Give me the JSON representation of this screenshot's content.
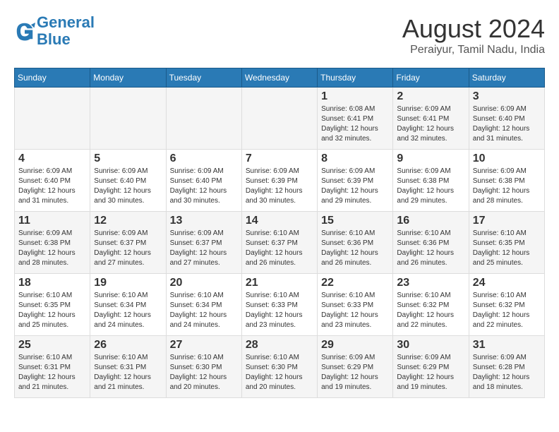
{
  "logo": {
    "line1": "General",
    "line2": "Blue"
  },
  "title": "August 2024",
  "subtitle": "Peraiyur, Tamil Nadu, India",
  "days_of_week": [
    "Sunday",
    "Monday",
    "Tuesday",
    "Wednesday",
    "Thursday",
    "Friday",
    "Saturday"
  ],
  "weeks": [
    [
      {
        "day": "",
        "info": ""
      },
      {
        "day": "",
        "info": ""
      },
      {
        "day": "",
        "info": ""
      },
      {
        "day": "",
        "info": ""
      },
      {
        "day": "1",
        "info": "Sunrise: 6:08 AM\nSunset: 6:41 PM\nDaylight: 12 hours\nand 32 minutes."
      },
      {
        "day": "2",
        "info": "Sunrise: 6:09 AM\nSunset: 6:41 PM\nDaylight: 12 hours\nand 32 minutes."
      },
      {
        "day": "3",
        "info": "Sunrise: 6:09 AM\nSunset: 6:40 PM\nDaylight: 12 hours\nand 31 minutes."
      }
    ],
    [
      {
        "day": "4",
        "info": "Sunrise: 6:09 AM\nSunset: 6:40 PM\nDaylight: 12 hours\nand 31 minutes."
      },
      {
        "day": "5",
        "info": "Sunrise: 6:09 AM\nSunset: 6:40 PM\nDaylight: 12 hours\nand 30 minutes."
      },
      {
        "day": "6",
        "info": "Sunrise: 6:09 AM\nSunset: 6:40 PM\nDaylight: 12 hours\nand 30 minutes."
      },
      {
        "day": "7",
        "info": "Sunrise: 6:09 AM\nSunset: 6:39 PM\nDaylight: 12 hours\nand 30 minutes."
      },
      {
        "day": "8",
        "info": "Sunrise: 6:09 AM\nSunset: 6:39 PM\nDaylight: 12 hours\nand 29 minutes."
      },
      {
        "day": "9",
        "info": "Sunrise: 6:09 AM\nSunset: 6:38 PM\nDaylight: 12 hours\nand 29 minutes."
      },
      {
        "day": "10",
        "info": "Sunrise: 6:09 AM\nSunset: 6:38 PM\nDaylight: 12 hours\nand 28 minutes."
      }
    ],
    [
      {
        "day": "11",
        "info": "Sunrise: 6:09 AM\nSunset: 6:38 PM\nDaylight: 12 hours\nand 28 minutes."
      },
      {
        "day": "12",
        "info": "Sunrise: 6:09 AM\nSunset: 6:37 PM\nDaylight: 12 hours\nand 27 minutes."
      },
      {
        "day": "13",
        "info": "Sunrise: 6:09 AM\nSunset: 6:37 PM\nDaylight: 12 hours\nand 27 minutes."
      },
      {
        "day": "14",
        "info": "Sunrise: 6:10 AM\nSunset: 6:37 PM\nDaylight: 12 hours\nand 26 minutes."
      },
      {
        "day": "15",
        "info": "Sunrise: 6:10 AM\nSunset: 6:36 PM\nDaylight: 12 hours\nand 26 minutes."
      },
      {
        "day": "16",
        "info": "Sunrise: 6:10 AM\nSunset: 6:36 PM\nDaylight: 12 hours\nand 26 minutes."
      },
      {
        "day": "17",
        "info": "Sunrise: 6:10 AM\nSunset: 6:35 PM\nDaylight: 12 hours\nand 25 minutes."
      }
    ],
    [
      {
        "day": "18",
        "info": "Sunrise: 6:10 AM\nSunset: 6:35 PM\nDaylight: 12 hours\nand 25 minutes."
      },
      {
        "day": "19",
        "info": "Sunrise: 6:10 AM\nSunset: 6:34 PM\nDaylight: 12 hours\nand 24 minutes."
      },
      {
        "day": "20",
        "info": "Sunrise: 6:10 AM\nSunset: 6:34 PM\nDaylight: 12 hours\nand 24 minutes."
      },
      {
        "day": "21",
        "info": "Sunrise: 6:10 AM\nSunset: 6:33 PM\nDaylight: 12 hours\nand 23 minutes."
      },
      {
        "day": "22",
        "info": "Sunrise: 6:10 AM\nSunset: 6:33 PM\nDaylight: 12 hours\nand 23 minutes."
      },
      {
        "day": "23",
        "info": "Sunrise: 6:10 AM\nSunset: 6:32 PM\nDaylight: 12 hours\nand 22 minutes."
      },
      {
        "day": "24",
        "info": "Sunrise: 6:10 AM\nSunset: 6:32 PM\nDaylight: 12 hours\nand 22 minutes."
      }
    ],
    [
      {
        "day": "25",
        "info": "Sunrise: 6:10 AM\nSunset: 6:31 PM\nDaylight: 12 hours\nand 21 minutes."
      },
      {
        "day": "26",
        "info": "Sunrise: 6:10 AM\nSunset: 6:31 PM\nDaylight: 12 hours\nand 21 minutes."
      },
      {
        "day": "27",
        "info": "Sunrise: 6:10 AM\nSunset: 6:30 PM\nDaylight: 12 hours\nand 20 minutes."
      },
      {
        "day": "28",
        "info": "Sunrise: 6:10 AM\nSunset: 6:30 PM\nDaylight: 12 hours\nand 20 minutes."
      },
      {
        "day": "29",
        "info": "Sunrise: 6:09 AM\nSunset: 6:29 PM\nDaylight: 12 hours\nand 19 minutes."
      },
      {
        "day": "30",
        "info": "Sunrise: 6:09 AM\nSunset: 6:29 PM\nDaylight: 12 hours\nand 19 minutes."
      },
      {
        "day": "31",
        "info": "Sunrise: 6:09 AM\nSunset: 6:28 PM\nDaylight: 12 hours\nand 18 minutes."
      }
    ]
  ]
}
